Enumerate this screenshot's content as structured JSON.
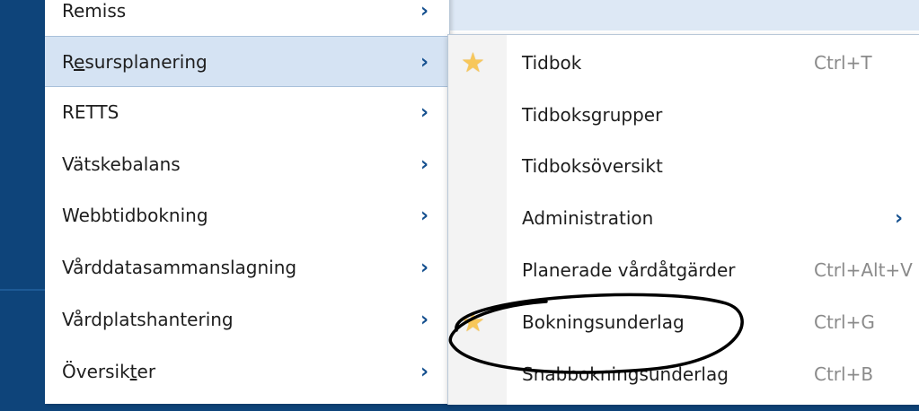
{
  "main_menu": {
    "items": [
      {
        "label": "Remiss",
        "prefix": "",
        "u": "",
        "suffix": ""
      },
      {
        "label": "",
        "prefix": "R",
        "u": "e",
        "suffix": "sursplanering"
      },
      {
        "label": "RETTS",
        "prefix": "",
        "u": "",
        "suffix": ""
      },
      {
        "label": "Vätskebalans",
        "prefix": "",
        "u": "",
        "suffix": ""
      },
      {
        "label": "Webbtidbokning",
        "prefix": "",
        "u": "",
        "suffix": ""
      },
      {
        "label": "Vårddatasammanslagning",
        "prefix": "",
        "u": "",
        "suffix": ""
      },
      {
        "label": "Vårdplatshantering",
        "prefix": "",
        "u": "",
        "suffix": ""
      },
      {
        "label": "",
        "prefix": "Översik",
        "u": "t",
        "suffix": "er"
      }
    ],
    "chevron": "›"
  },
  "sub_menu": {
    "items": [
      {
        "label": "Tidbok",
        "shortcut": "Ctrl+T",
        "favorite": true
      },
      {
        "label": "Tidboksgrupper",
        "shortcut": "",
        "favorite": false
      },
      {
        "label": "Tidboksöversikt",
        "shortcut": "",
        "favorite": false
      },
      {
        "label": "Administration",
        "shortcut": "",
        "favorite": false
      },
      {
        "label": "Planerade vårdåtgärder",
        "shortcut": "Ctrl+Alt+V",
        "favorite": false
      },
      {
        "label": "Bokningsunderlag",
        "shortcut": "Ctrl+G",
        "favorite": true
      },
      {
        "label": "Snabbokningsunderlag",
        "shortcut": "Ctrl+B",
        "favorite": false
      }
    ],
    "star_glyph": "★",
    "chevron": "›"
  },
  "colors": {
    "sidebar": "#0e447a",
    "active_item": "#d5e3f3",
    "chevron": "#15508f",
    "star": "#f7c75a",
    "shortcut": "#8a8a8a"
  }
}
